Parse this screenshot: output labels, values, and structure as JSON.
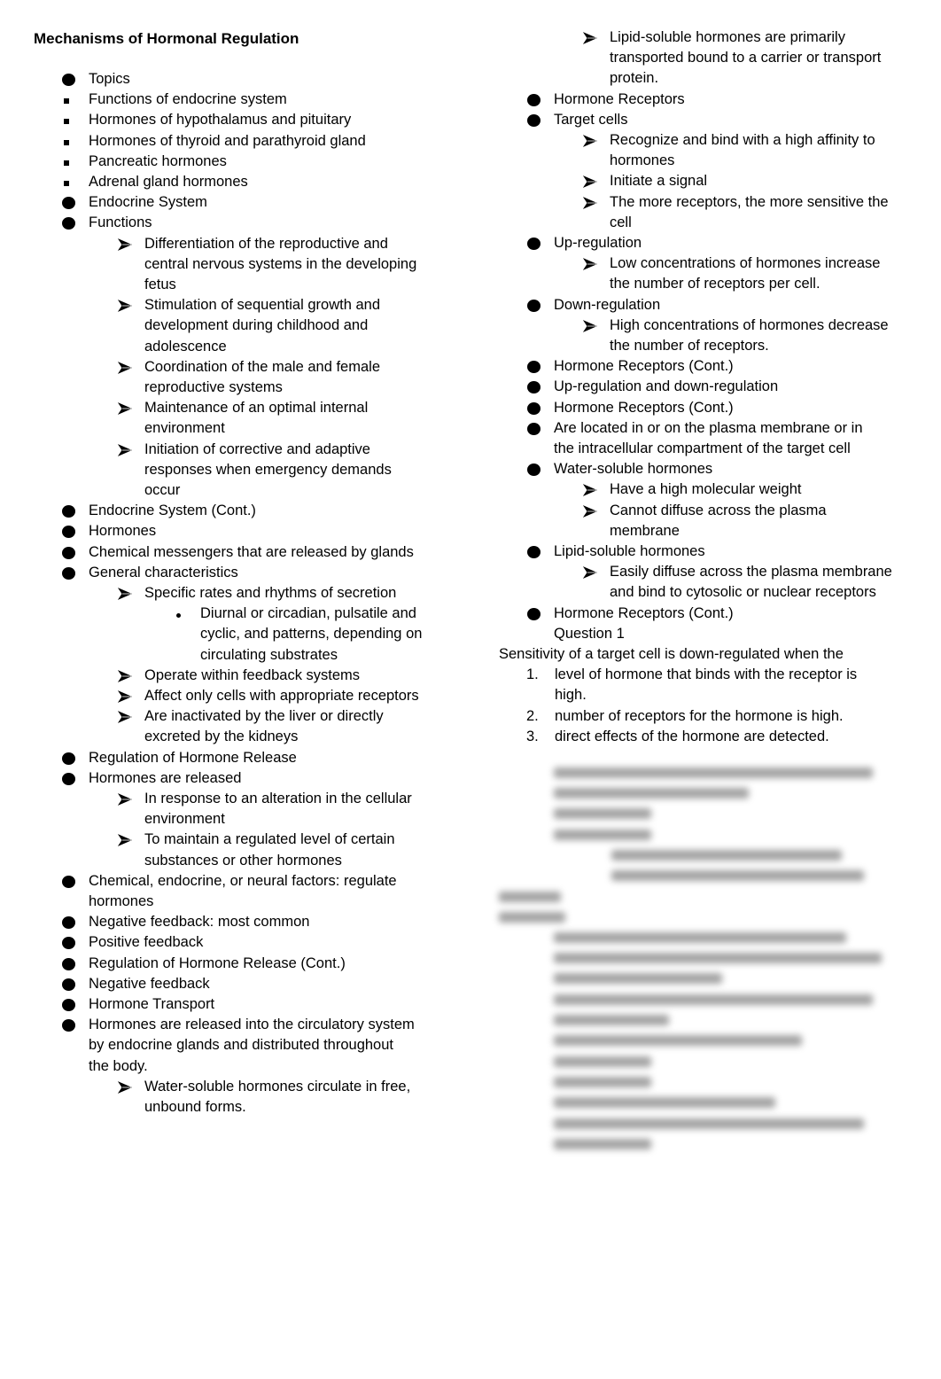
{
  "document": {
    "title": "Mechanisms of Hormonal Regulation",
    "left_column": [
      {
        "level": "dot",
        "lines": [
          "Topics"
        ]
      },
      {
        "level": "square",
        "lines": [
          "Functions of endocrine system"
        ]
      },
      {
        "level": "square",
        "lines": [
          "Hormones of hypothalamus and pituitary"
        ]
      },
      {
        "level": "square",
        "lines": [
          "Hormones of thyroid and parathyroid gland"
        ]
      },
      {
        "level": "square",
        "lines": [
          "Pancreatic hormones"
        ]
      },
      {
        "level": "square",
        "lines": [
          "Adrenal gland hormones"
        ]
      },
      {
        "level": "dot",
        "lines": [
          "Endocrine System"
        ]
      },
      {
        "level": "dot",
        "lines": [
          "Functions"
        ]
      },
      {
        "level": "arrow",
        "lines": [
          "Differentiation of the reproductive and",
          "central nervous systems in the developing",
          "fetus"
        ]
      },
      {
        "level": "arrow",
        "lines": [
          "Stimulation of sequential growth and",
          "development during childhood and",
          "adolescence"
        ]
      },
      {
        "level": "arrow",
        "lines": [
          "Coordination of the male and female",
          "reproductive systems"
        ]
      },
      {
        "level": "arrow",
        "lines": [
          "Maintenance of an optimal internal",
          "environment"
        ]
      },
      {
        "level": "arrow",
        "lines": [
          "Initiation of corrective and adaptive",
          "responses when emergency demands",
          "occur"
        ]
      },
      {
        "level": "dot",
        "lines": [
          "Endocrine System (Cont.)"
        ]
      },
      {
        "level": "dot",
        "lines": [
          "Hormones"
        ]
      },
      {
        "level": "dot",
        "lines": [
          "Chemical messengers that are released by glands"
        ]
      },
      {
        "level": "dot",
        "lines": [
          "General characteristics"
        ]
      },
      {
        "level": "arrow",
        "lines": [
          "Specific rates and rhythms of secretion"
        ]
      },
      {
        "level": "small-dot",
        "lines": [
          "Diurnal or circadian, pulsatile and",
          "cyclic, and patterns, depending on",
          "circulating substrates"
        ]
      },
      {
        "level": "arrow",
        "lines": [
          "Operate within feedback systems"
        ]
      },
      {
        "level": "arrow",
        "lines": [
          "Affect only cells with appropriate receptors"
        ]
      },
      {
        "level": "arrow",
        "lines": [
          "Are inactivated by the liver or directly",
          "excreted by the kidneys"
        ]
      },
      {
        "level": "dot",
        "lines": [
          "Regulation of Hormone Release"
        ]
      },
      {
        "level": "dot",
        "lines": [
          "Hormones are released"
        ]
      },
      {
        "level": "arrow",
        "lines": [
          "In response to an alteration in the cellular",
          "environment"
        ]
      },
      {
        "level": "arrow",
        "lines": [
          "To maintain a regulated level of certain",
          "substances or other hormones"
        ]
      },
      {
        "level": "dot",
        "lines": [
          "Chemical, endocrine, or neural factors: regulate",
          "hormones"
        ]
      },
      {
        "level": "dot",
        "lines": [
          "Negative feedback: most common"
        ]
      },
      {
        "level": "dot",
        "lines": [
          "Positive feedback"
        ]
      },
      {
        "level": "dot",
        "lines": [
          "Regulation of Hormone Release (Cont.)"
        ]
      },
      {
        "level": "dot",
        "lines": [
          "Negative feedback"
        ]
      },
      {
        "level": "dot",
        "lines": [
          "Hormone Transport"
        ]
      },
      {
        "level": "dot",
        "lines": [
          "Hormones are released into the circulatory system",
          "by endocrine glands and distributed throughout",
          "the body."
        ]
      },
      {
        "level": "arrow",
        "lines": [
          "Water-soluble hormones circulate in free,",
          "unbound forms."
        ]
      }
    ],
    "right_column": [
      {
        "level": "arrow",
        "lines": [
          "Lipid-soluble hormones are primarily",
          "transported bound to a carrier or transport",
          "protein."
        ]
      },
      {
        "level": "dot",
        "lines": [
          "Hormone Receptors"
        ]
      },
      {
        "level": "dot",
        "lines": [
          "Target cells"
        ]
      },
      {
        "level": "arrow",
        "lines": [
          "Recognize and bind with a high affinity to",
          "hormones"
        ]
      },
      {
        "level": "arrow",
        "lines": [
          "Initiate a signal"
        ]
      },
      {
        "level": "arrow",
        "lines": [
          "The more receptors, the more sensitive the",
          "cell"
        ]
      },
      {
        "level": "dot",
        "lines": [
          "Up-regulation"
        ]
      },
      {
        "level": "arrow",
        "lines": [
          "Low concentrations of hormones increase",
          "the number of receptors per cell."
        ]
      },
      {
        "level": "dot",
        "lines": [
          "Down-regulation"
        ]
      },
      {
        "level": "arrow",
        "lines": [
          "High concentrations of hormones decrease",
          "the number of receptors."
        ]
      },
      {
        "level": "dot",
        "lines": [
          "Hormone Receptors (Cont.)"
        ]
      },
      {
        "level": "dot",
        "lines": [
          "Up-regulation and down-regulation"
        ]
      },
      {
        "level": "dot",
        "lines": [
          "Hormone Receptors (Cont.)"
        ]
      },
      {
        "level": "dot",
        "lines": [
          "Are located in or on the plasma membrane or in",
          "the intracellular compartment of the target cell"
        ]
      },
      {
        "level": "dot",
        "lines": [
          "Water-soluble hormones"
        ]
      },
      {
        "level": "arrow",
        "lines": [
          "Have a high molecular weight"
        ]
      },
      {
        "level": "arrow",
        "lines": [
          "Cannot diffuse across the plasma",
          "membrane"
        ]
      },
      {
        "level": "dot",
        "lines": [
          "Lipid-soluble hormones"
        ]
      },
      {
        "level": "arrow",
        "lines": [
          "Easily diffuse across the plasma membrane",
          "and bind to cytosolic or nuclear receptors"
        ]
      },
      {
        "level": "dot",
        "lines": [
          "Hormone Receptors (Cont.)",
          "Question 1"
        ]
      }
    ],
    "question": {
      "stem": "Sensitivity of a target cell is down-regulated when the",
      "options": [
        {
          "number": "1.",
          "lines": [
            "level of hormone that binds with the receptor is",
            "high."
          ]
        },
        {
          "number": "2.",
          "lines": [
            "number of receptors for the hormone is high."
          ]
        },
        {
          "number": "3.",
          "lines": [
            "direct effects of the hormone are detected."
          ]
        }
      ]
    },
    "blurred_notice": "remaining content obscured"
  }
}
